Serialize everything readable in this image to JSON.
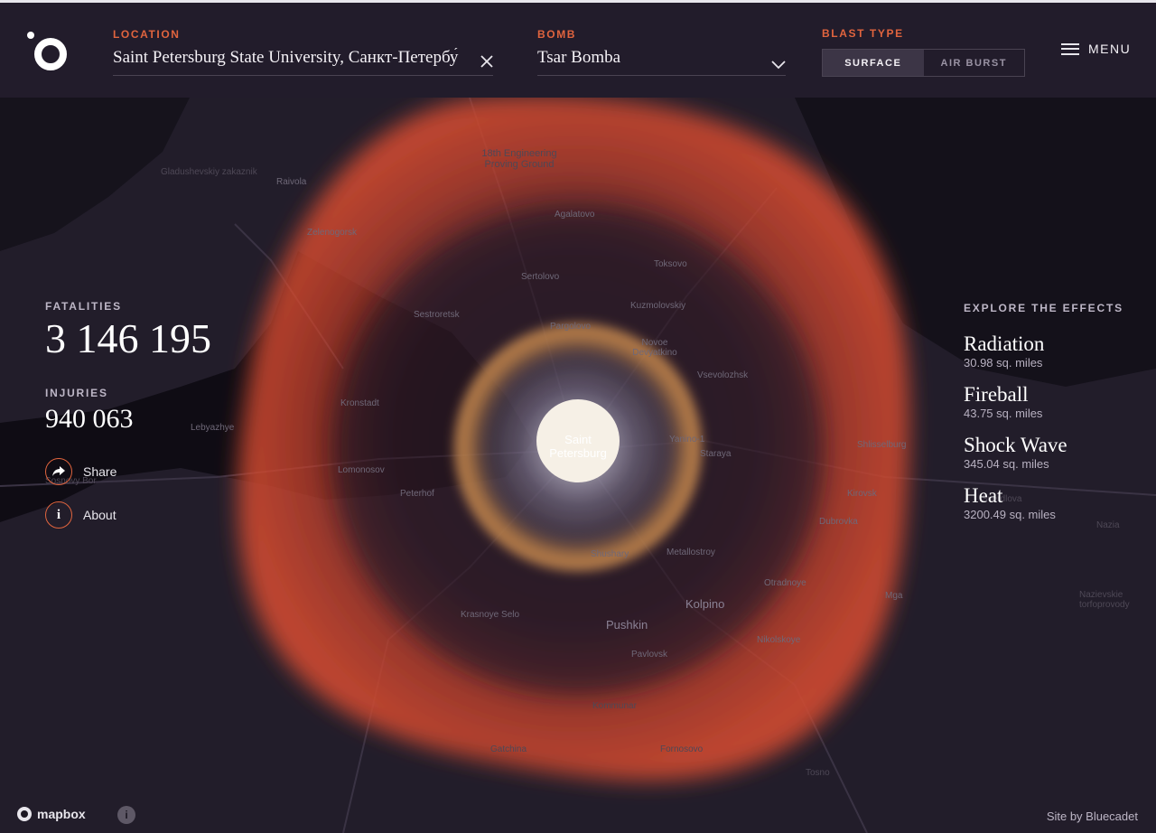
{
  "header": {
    "location_label": "LOCATION",
    "location_value": "Saint Petersburg State University, Санкт-Петербу́",
    "bomb_label": "BOMB",
    "bomb_value": "Tsar Bomba",
    "blast_label": "BLAST TYPE",
    "blast_options": [
      "SURFACE",
      "AIR BURST"
    ],
    "blast_selected": "SURFACE",
    "menu_label": "MENU"
  },
  "stats": {
    "fatalities_label": "FATALITIES",
    "fatalities_value": "3 146 195",
    "injuries_label": "INJURIES",
    "injuries_value": "940 063"
  },
  "actions": {
    "share_label": "Share",
    "about_label": "About"
  },
  "effects": {
    "title": "EXPLORE THE EFFECTS",
    "items": [
      {
        "name": "Radiation",
        "area": "30.98 sq. miles"
      },
      {
        "name": "Fireball",
        "area": "43.75 sq. miles"
      },
      {
        "name": "Shock Wave",
        "area": "345.04 sq. miles"
      },
      {
        "name": "Heat",
        "area": "3200.49 sq. miles"
      }
    ]
  },
  "map": {
    "center_label": "Saint Petersburg",
    "places": [
      "Gladushevskiy zakaznik",
      "Raivola",
      "Zelenogorsk",
      "18th Engineering Proving Ground",
      "Agalatovo",
      "Toksovo",
      "Sertolovo",
      "Kuzmolovskiy",
      "Sestroretsk",
      "Pargolovo",
      "Novoe Devyatkino",
      "Vsevolozhsk",
      "Kronstadt",
      "Lebyazhye",
      "Yanino-1",
      "Staraya",
      "Shlisselburg",
      "Lomonosov",
      "Sosnovy Bor",
      "Peterhof",
      "Kirovsk",
      "Sverdlova",
      "Dubrovka",
      "Nazia",
      "Shushary",
      "Metallostroy",
      "Otradnoye",
      "Mga",
      "Nazievskie torfoprovody",
      "Krasnoye Selo",
      "Pushkin",
      "Kolpino",
      "Pavlovsk",
      "Nikolskoye",
      "Kommunar",
      "Gatchina",
      "Fornosovo",
      "Tosno"
    ],
    "attribution": "mapbox",
    "info_icon": "i"
  },
  "credit": "Site by Bluecadet",
  "colors": {
    "accent": "#e0643e",
    "header_bg": "#221c2b",
    "map_bg": "#1b1722",
    "heat_ring": "#c2402c",
    "shockwave_ring": "#c98b52",
    "fireball": "#f6f0e6"
  }
}
